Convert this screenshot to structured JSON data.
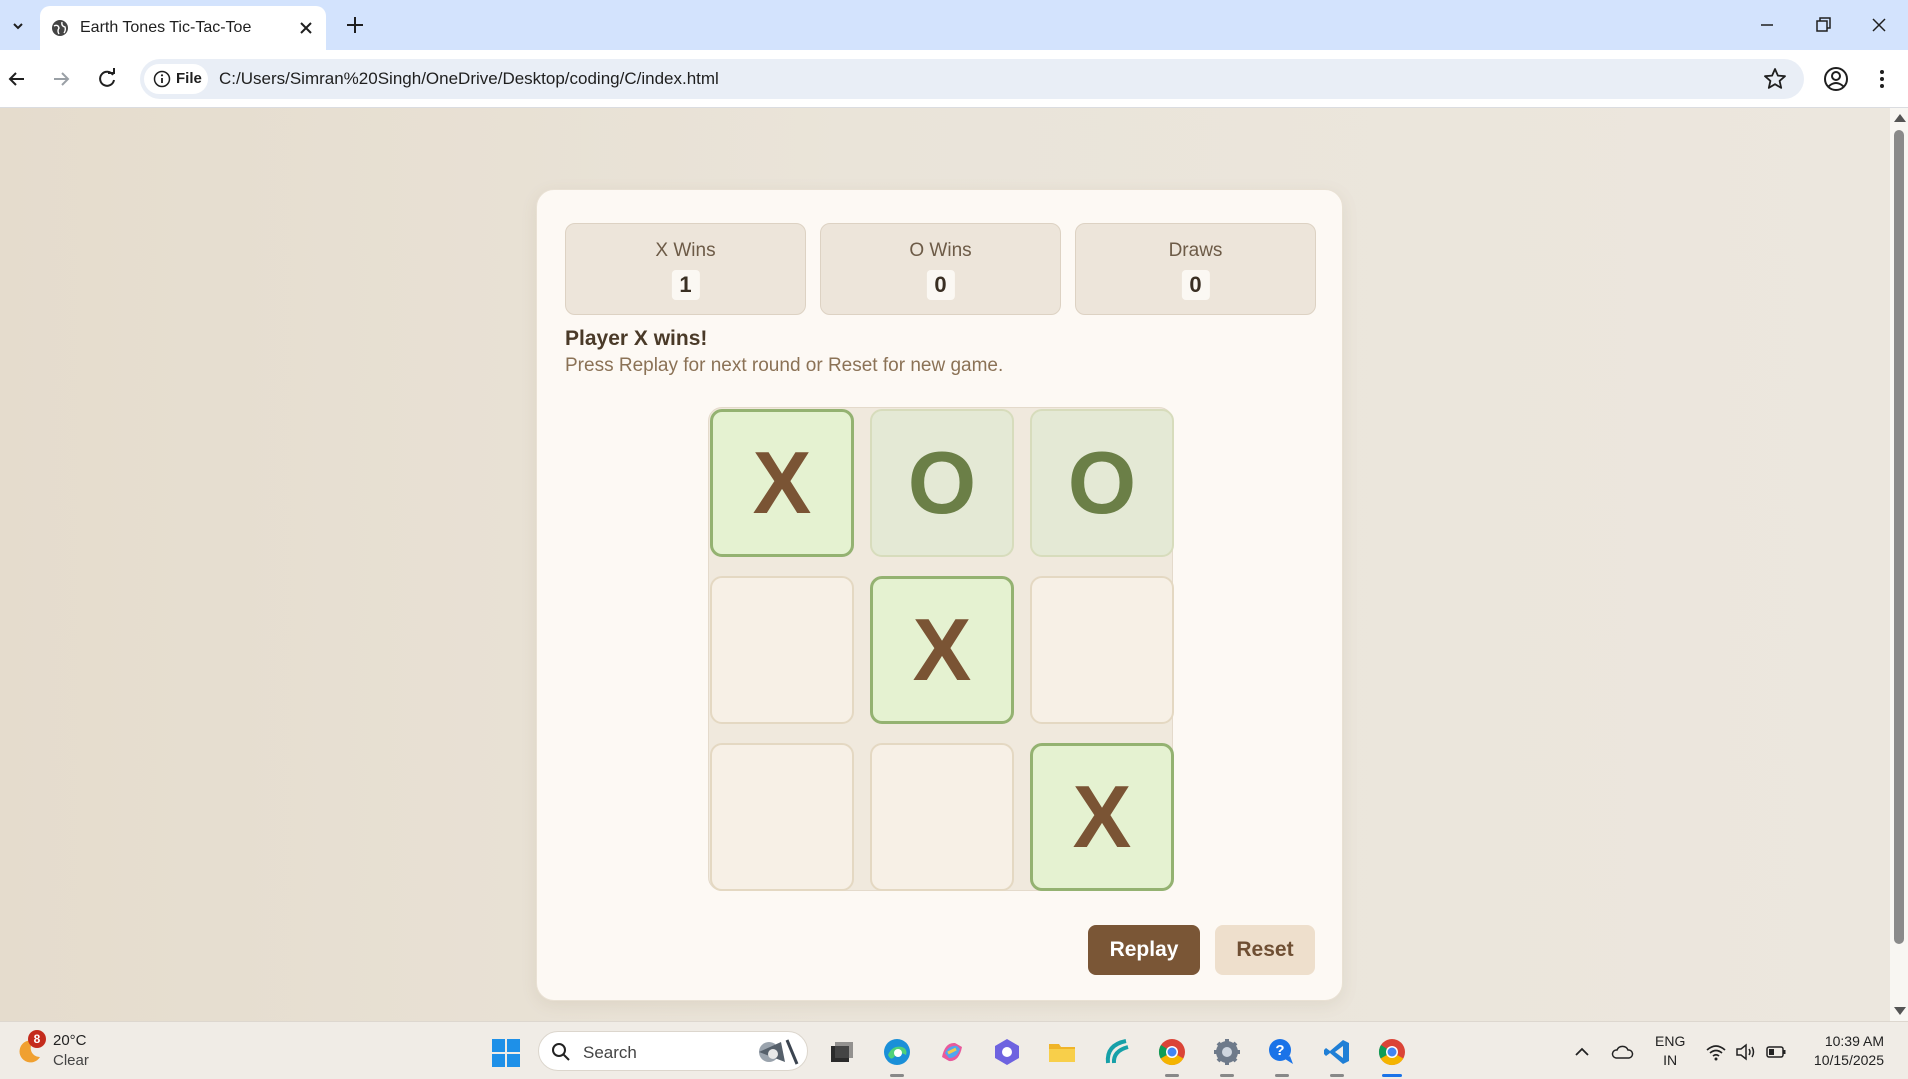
{
  "browser": {
    "tab_title": "Earth Tones Tic-Tac-Toe",
    "site_chip": "File",
    "url": "C:/Users/Simran%20Singh/OneDrive/Desktop/coding/C/index.html"
  },
  "scores": {
    "x": {
      "label": "X Wins",
      "value": "1"
    },
    "o": {
      "label": "O Wins",
      "value": "0"
    },
    "draws": {
      "label": "Draws",
      "value": "0"
    }
  },
  "status": {
    "title": "Player X wins!",
    "subtitle": "Press Replay for next round or Reset for new game."
  },
  "board": {
    "cells": [
      "X",
      "O",
      "O",
      "",
      "X",
      "",
      "",
      "",
      "X"
    ],
    "winning_line": [
      0,
      4,
      8
    ]
  },
  "buttons": {
    "replay": "Replay",
    "reset": "Reset"
  },
  "taskbar": {
    "weather_badge": "8",
    "weather_temp": "20°C",
    "weather_desc": "Clear",
    "search_placeholder": "Search",
    "lang_line1": "ENG",
    "lang_line2": "IN",
    "time": "10:39 AM",
    "date": "10/15/2025"
  },
  "colors": {
    "x_mark": "#7a5434",
    "o_mark": "#6b7f47",
    "replay_button": "#7a5636",
    "reset_button": "#eedfcc",
    "win_cell": "#e5f2d1"
  }
}
